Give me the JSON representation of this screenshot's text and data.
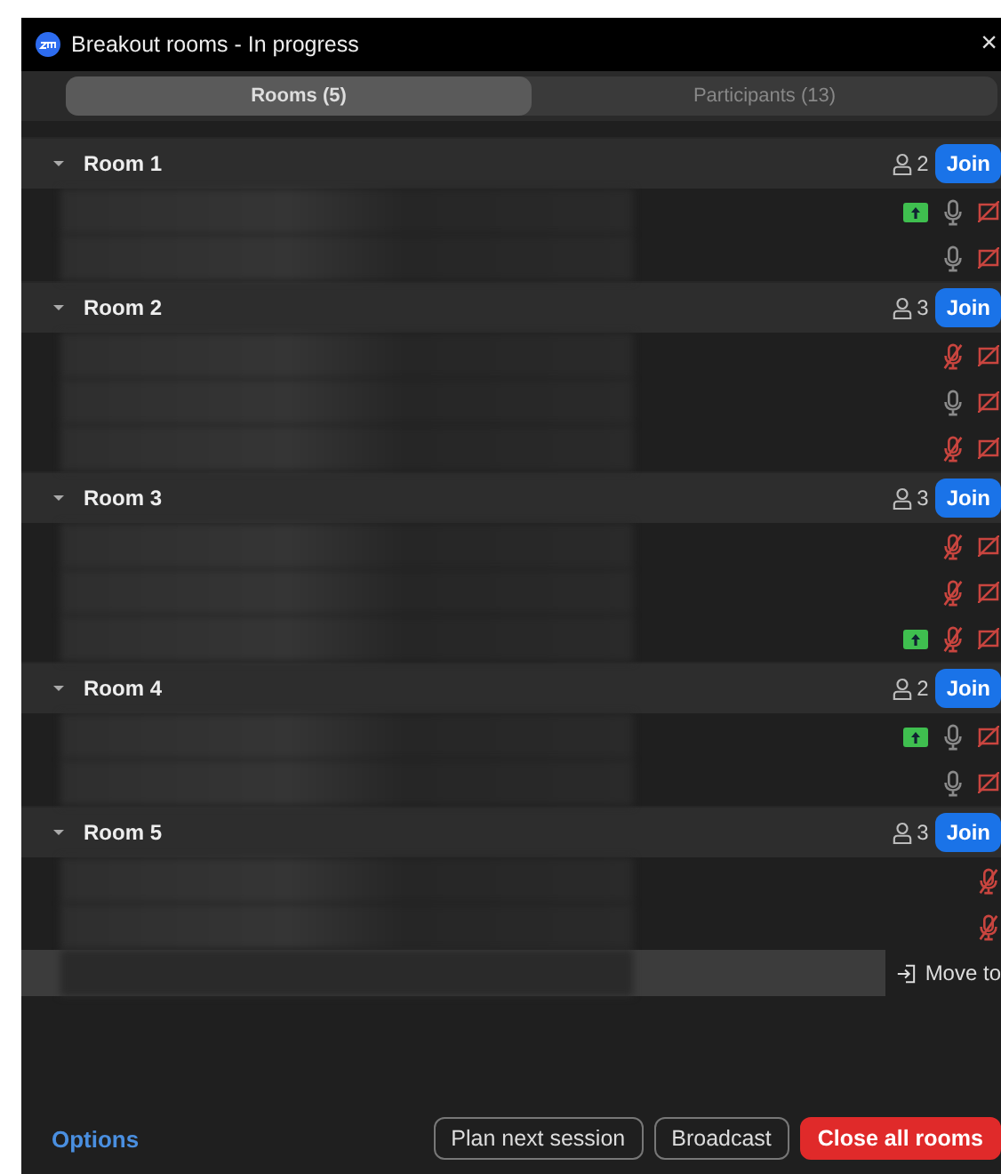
{
  "window": {
    "title": "Breakout rooms - In progress",
    "close": "×"
  },
  "tabs": [
    {
      "label": "Rooms (5)",
      "selected": true
    },
    {
      "label": "Participants (13)",
      "selected": false
    }
  ],
  "rooms": [
    {
      "name": "Room 1",
      "expanded": true,
      "count": "2",
      "join": "Join",
      "participants": [
        {
          "kind": "icons",
          "sharing": true,
          "muted": false,
          "video_off": true
        },
        {
          "kind": "icons",
          "sharing": false,
          "muted": false,
          "video_off": true
        }
      ]
    },
    {
      "name": "Room 2",
      "expanded": true,
      "count": "3",
      "join": "Join",
      "participants": [
        {
          "kind": "icons",
          "sharing": false,
          "muted": true,
          "video_off": true
        },
        {
          "kind": "icons",
          "sharing": false,
          "muted": false,
          "video_off": true
        },
        {
          "kind": "icons",
          "sharing": false,
          "muted": true,
          "video_off": true
        }
      ]
    },
    {
      "name": "Room 3",
      "expanded": true,
      "count": "3",
      "join": "Join",
      "participants": [
        {
          "kind": "icons",
          "sharing": false,
          "muted": true,
          "video_off": true
        },
        {
          "kind": "icons",
          "sharing": false,
          "muted": true,
          "video_off": true
        },
        {
          "kind": "icons",
          "sharing": true,
          "muted": true,
          "video_off": true
        }
      ]
    },
    {
      "name": "Room 4",
      "expanded": true,
      "count": "2",
      "join": "Join",
      "participants": [
        {
          "kind": "icons",
          "sharing": true,
          "muted": false,
          "video_off": true
        },
        {
          "kind": "icons",
          "sharing": false,
          "muted": false,
          "video_off": true
        }
      ]
    },
    {
      "name": "Room 5",
      "expanded": true,
      "count": "3",
      "join": "Join",
      "participants": [
        {
          "kind": "icons",
          "sharing": false,
          "muted": true,
          "video_off": false
        },
        {
          "kind": "icons",
          "sharing": false,
          "muted": true,
          "video_off": false
        },
        {
          "kind": "hover",
          "action": "Move to"
        }
      ]
    }
  ],
  "footer": {
    "options": "Options",
    "buttons": [
      {
        "label": "Plan next session",
        "kind": "outline"
      },
      {
        "label": "Broadcast",
        "kind": "outline"
      },
      {
        "label": "Close all rooms",
        "kind": "danger"
      }
    ]
  }
}
